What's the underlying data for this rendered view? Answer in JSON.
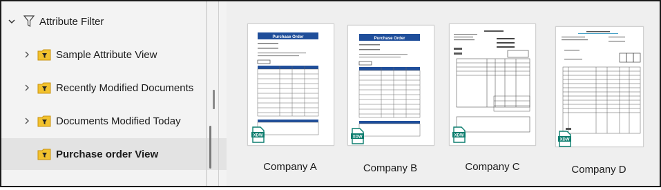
{
  "tree": {
    "root": {
      "label": "Attribute Filter",
      "icon": "filter-icon",
      "expanded": true
    },
    "items": [
      {
        "label": "Sample Attribute View",
        "icon": "filter-folder-icon",
        "expanded": false,
        "selected": false
      },
      {
        "label": "Recently Modified Documents",
        "icon": "filter-folder-icon",
        "expanded": false,
        "selected": false
      },
      {
        "label": "Documents Modified Today",
        "icon": "filter-folder-icon",
        "expanded": false,
        "selected": false
      },
      {
        "label": "Purchase order View",
        "icon": "filter-folder-icon",
        "selected": true
      }
    ]
  },
  "files": [
    {
      "name": "Company A",
      "doc_title": "Purchase Order",
      "badge": "XDW"
    },
    {
      "name": "Company B",
      "doc_title": "Purchase Order",
      "badge": "XDW"
    },
    {
      "name": "Company C",
      "badge": "XDW"
    },
    {
      "name": "Company D",
      "badge": "XDW"
    }
  ],
  "colors": {
    "folder_fill": "#f2c22e",
    "folder_dark": "#c99312",
    "doc_header_blue": "#1f4e9a",
    "xdw_teal": "#0b7d6e"
  }
}
